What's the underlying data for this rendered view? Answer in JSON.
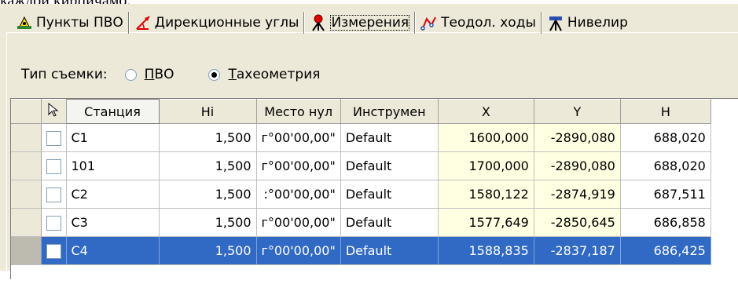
{
  "caption_fragment": "каждой кирпичамо.",
  "tabs": [
    {
      "label": "Пункты ПВО",
      "icon": "control-points-icon"
    },
    {
      "label": "Дирекционные углы",
      "icon": "bearing-angle-icon"
    },
    {
      "label": "Измерения",
      "icon": "tripod-station-icon",
      "active": true
    },
    {
      "label": "Теодол. ходы",
      "icon": "traverse-icon"
    },
    {
      "label": "Нивелир",
      "icon": "level-instrument-icon"
    }
  ],
  "survey_type": {
    "label": "Тип съемки:",
    "options": [
      {
        "label": "ПВО",
        "underline": "П",
        "rest": "ВО",
        "selected": false
      },
      {
        "label": "Тахеометрия",
        "underline": "Т",
        "rest": "ахеометрия",
        "selected": true
      }
    ]
  },
  "table": {
    "columns": [
      "Станция",
      "Hi",
      "Место нул",
      "Инструмен",
      "X",
      "Y",
      "H"
    ],
    "rows": [
      [
        "C1",
        "1,500",
        "г°00'00,00\"",
        "Default",
        "1600,000",
        "-2890,080",
        "688,020"
      ],
      [
        "101",
        "1,500",
        "г°00'00,00\"",
        "Default",
        "1700,000",
        "-2890,080",
        "688,020"
      ],
      [
        "C2",
        "1,500",
        ":°00'00,00\"",
        "Default",
        "1580,122",
        "-2874,919",
        "687,511"
      ],
      [
        "C3",
        "1,500",
        "г°00'00,00\"",
        "Default",
        "1577,649",
        "-2850,645",
        "686,858"
      ],
      [
        "C4",
        "1,500",
        "г°00'00,00\"",
        "Default",
        "1588,835",
        "-2837,187",
        "686,425"
      ]
    ],
    "selected_row": 4
  },
  "colors": {
    "selection": "#316ac5",
    "coord_bg": "#ffffe1",
    "panel": "#ece9d8"
  }
}
